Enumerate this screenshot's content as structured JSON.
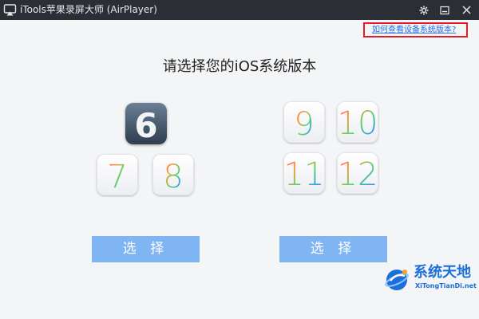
{
  "window": {
    "title": "iTools苹果录屏大师 (AirPlayer)",
    "controls": [
      "settings-icon",
      "minimize-icon",
      "close-icon"
    ]
  },
  "help_link": "如何查看设备系统版本?",
  "heading": "请选择您的iOS系统版本",
  "groups": [
    {
      "versions": [
        "6",
        "7",
        "8"
      ],
      "button_label": "选 择"
    },
    {
      "versions": [
        "9",
        "10",
        "11",
        "12"
      ],
      "button_label": "选 择"
    }
  ],
  "watermark": {
    "name": "系统天地",
    "url": "XiTongTianDi.net"
  },
  "colors": {
    "titlebar": "#2b2f35",
    "background": "#f4f5f7",
    "button": "#7fb5f2",
    "link": "#2a6ee0",
    "highlight_border": "#e21d25"
  }
}
